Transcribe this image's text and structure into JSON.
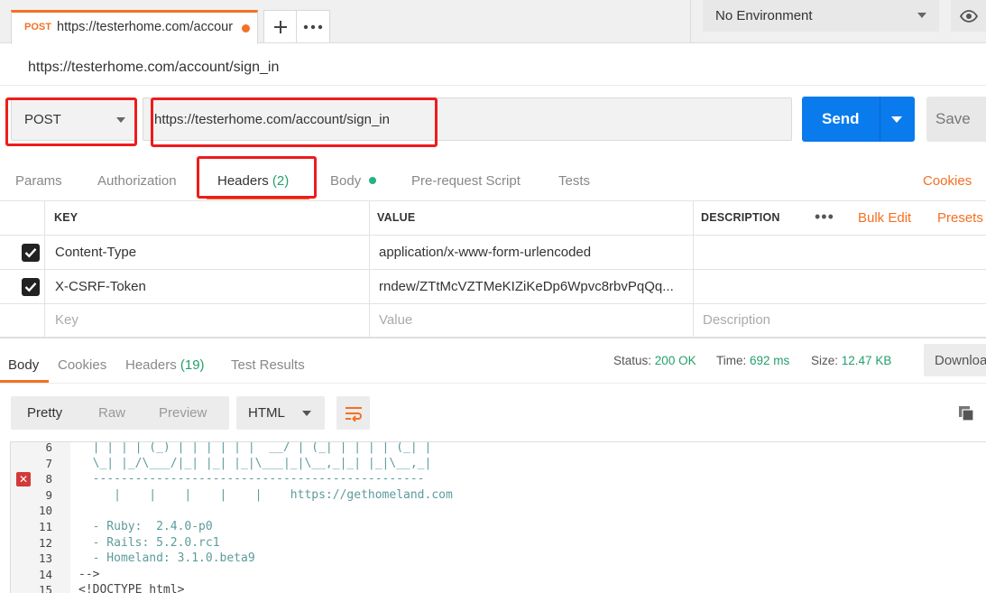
{
  "tab": {
    "method": "POST",
    "url": "https://testerhome.com/accour"
  },
  "environment": {
    "selected": "No Environment"
  },
  "request": {
    "name": "https://testerhome.com/account/sign_in",
    "method": "POST",
    "url": "https://testerhome.com/account/sign_in",
    "send_label": "Send",
    "save_label": "Save"
  },
  "request_tabs": {
    "params": "Params",
    "authorization": "Authorization",
    "headers": "Headers",
    "headers_count": "(2)",
    "body": "Body",
    "prerequest": "Pre-request Script",
    "tests": "Tests",
    "cookies": "Cookies"
  },
  "headers_table": {
    "columns": {
      "key": "KEY",
      "value": "VALUE",
      "description": "DESCRIPTION"
    },
    "bulk_edit": "Bulk Edit",
    "presets": "Presets",
    "rows": [
      {
        "key": "Content-Type",
        "value": "application/x-www-form-urlencoded",
        "description": ""
      },
      {
        "key": "X-CSRF-Token",
        "value": "rndew/ZTtMcVZTMeKIZiKeDp6Wpvc8rbvPqQq...",
        "description": ""
      }
    ],
    "placeholder": {
      "key": "Key",
      "value": "Value",
      "description": "Description"
    }
  },
  "response_tabs": {
    "body": "Body",
    "cookies": "Cookies",
    "headers": "Headers",
    "headers_count": "(19)",
    "test_results": "Test Results"
  },
  "response_meta": {
    "status_label": "Status:",
    "status_value": "200 OK",
    "time_label": "Time:",
    "time_value": "692 ms",
    "size_label": "Size:",
    "size_value": "12.47 KB",
    "download": "Download"
  },
  "view": {
    "pretty": "Pretty",
    "raw": "Raw",
    "preview": "Preview",
    "format": "HTML"
  },
  "code_lines": [
    {
      "n": "6",
      "text": "  | | | | (_) | | | | | |  __/ | (_| | | | | (_| |"
    },
    {
      "n": "7",
      "text": "  \\_| |_/\\___/|_| |_| |_|\\___|_|\\__,_|_| |_|\\__,_|"
    },
    {
      "n": "8",
      "text": "  -----------------------------------------------"
    },
    {
      "n": "9",
      "text": "     |    |    |    |    |    https://gethomeland.com"
    },
    {
      "n": "10",
      "text": ""
    },
    {
      "n": "11",
      "text": "  - Ruby:  2.4.0-p0"
    },
    {
      "n": "12",
      "text": "  - Rails: 5.2.0.rc1"
    },
    {
      "n": "13",
      "text": "  - Homeland: 3.1.0.beta9"
    },
    {
      "n": "14",
      "text": "-->"
    },
    {
      "n": "15",
      "text": "<!DOCTYPE html>"
    }
  ],
  "colors": {
    "accent": "#f47023",
    "send_blue": "#097bed",
    "success_green": "#24a06b",
    "annotation_red": "#ee1c1c"
  }
}
